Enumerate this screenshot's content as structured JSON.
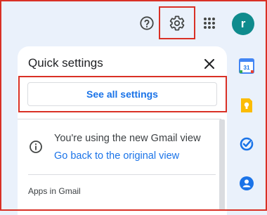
{
  "header": {
    "help_icon": "help-circle-icon",
    "settings_icon": "gear-icon",
    "apps_icon": "apps-grid-icon",
    "avatar_initial": "r",
    "avatar_color": "#0f8b8d"
  },
  "quick_settings": {
    "title": "Quick settings",
    "see_all_label": "See all settings",
    "notice_text": "You're using the new Gmail view",
    "notice_link": "Go back to the original view",
    "section_heading": "Apps in Gmail"
  },
  "side_panel": {
    "items": [
      {
        "icon": "calendar-icon",
        "text": "31"
      },
      {
        "icon": "keep-icon"
      },
      {
        "icon": "tasks-icon"
      },
      {
        "icon": "contacts-icon"
      }
    ]
  },
  "colors": {
    "accent": "#1a73e8",
    "highlight": "#d93025",
    "background": "#eaf1fb"
  }
}
